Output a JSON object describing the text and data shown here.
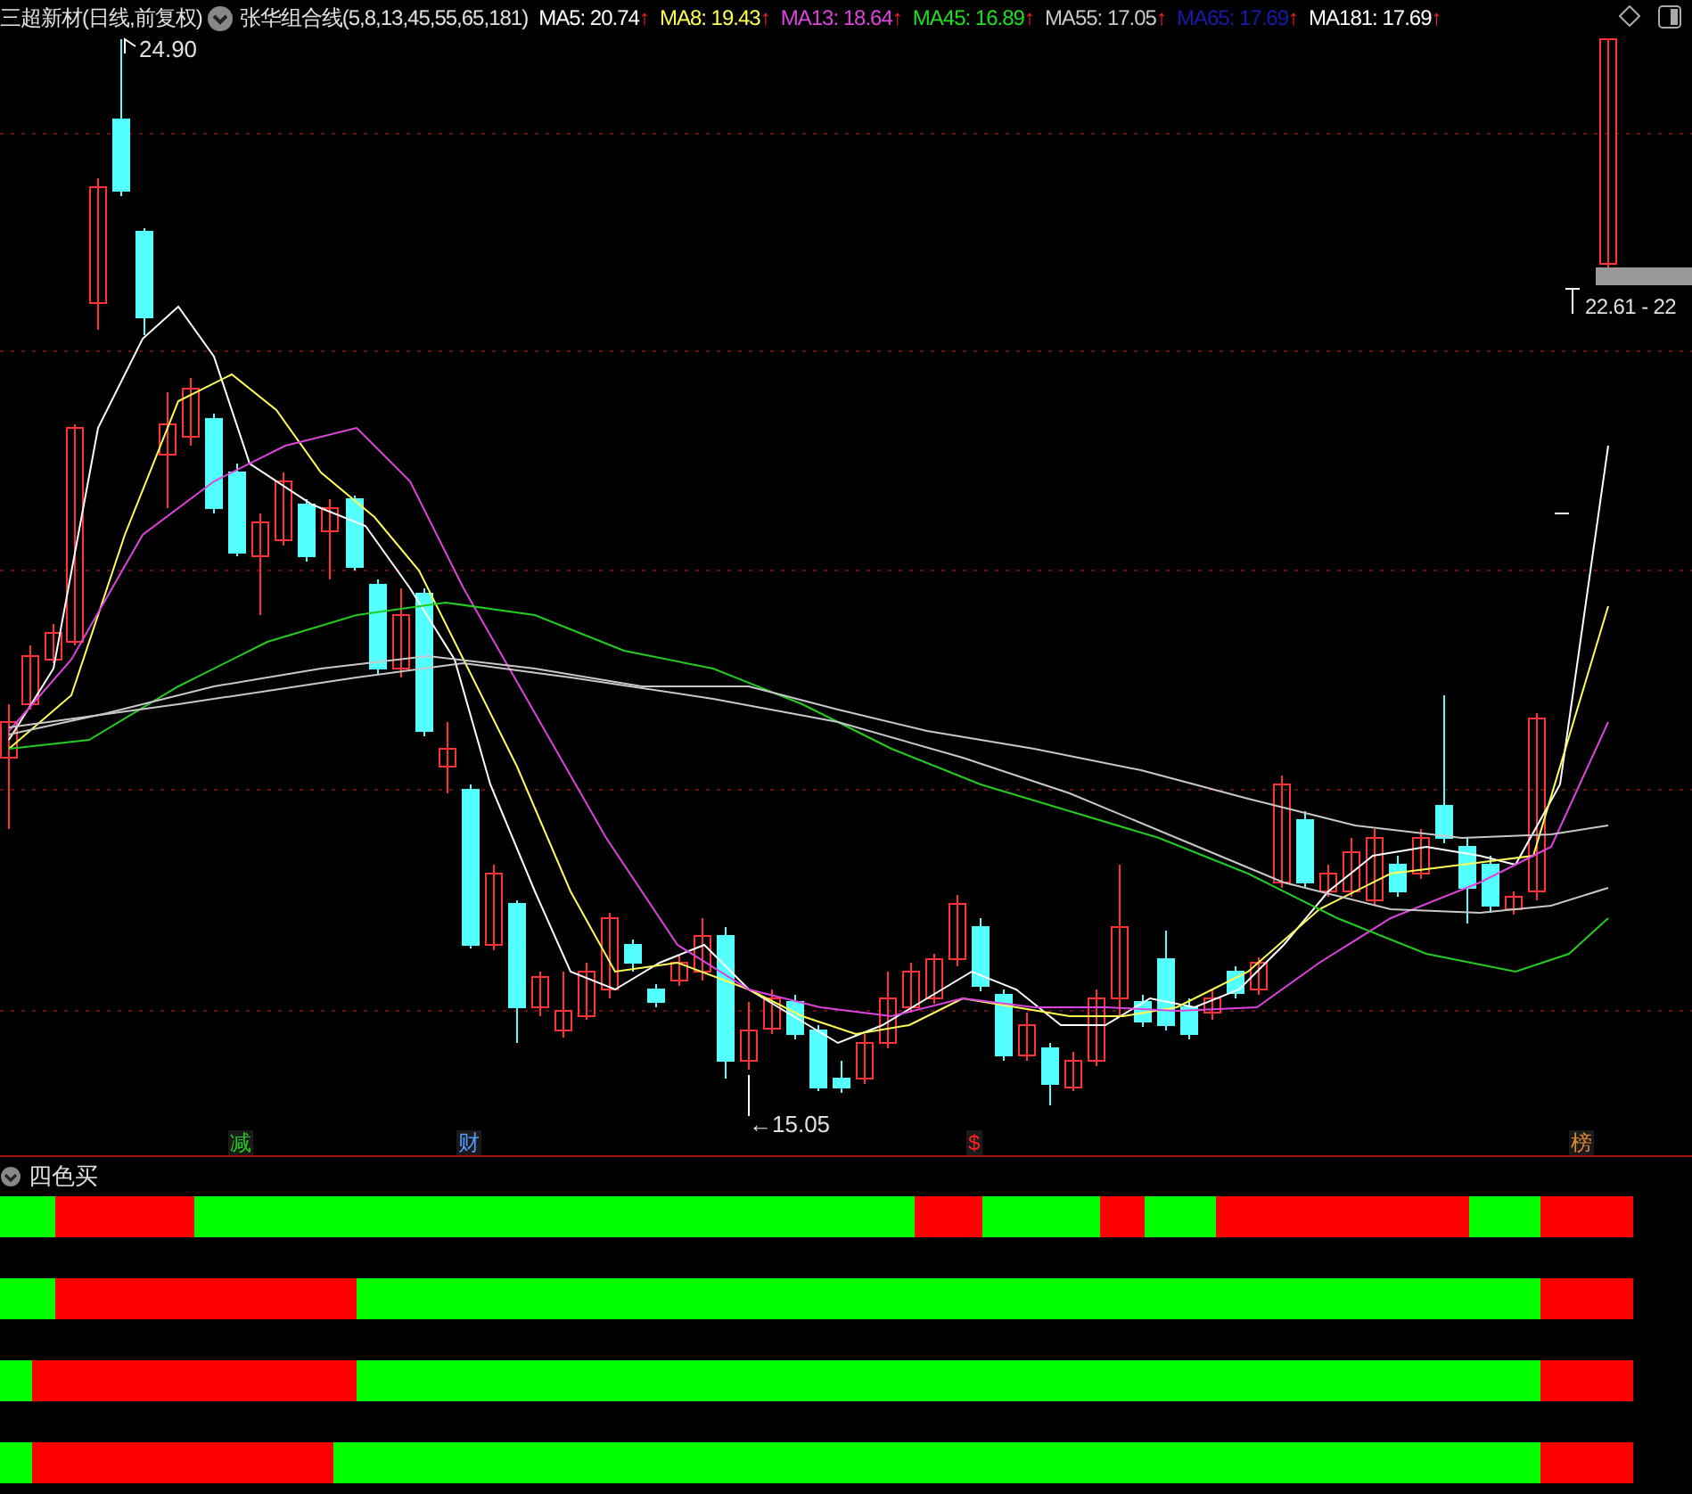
{
  "title": "三超新材(日线,前复权)",
  "indicator": {
    "name": "张华组合线(5,8,13,45,55,65,181)",
    "values": [
      {
        "label": "MA5: 20.74",
        "color": "#ffffff",
        "trend": "↑"
      },
      {
        "label": "MA8: 19.43",
        "color": "#ffff55",
        "trend": "↑"
      },
      {
        "label": "MA13: 18.64",
        "color": "#dd44dd",
        "trend": "↑"
      },
      {
        "label": "MA45: 16.89",
        "color": "#22dd22",
        "trend": "↑"
      },
      {
        "label": "MA55: 17.05",
        "color": "#c8c8c8",
        "trend": "↑"
      },
      {
        "label": "MA65: 17.69",
        "color": "#1a1aaa",
        "trend": "↑"
      },
      {
        "label": "MA181: 17.69",
        "color": "#ffffff",
        "trend": "↑"
      }
    ]
  },
  "high_label": "24.90",
  "low_label": "←15.05",
  "price_range_label": "22.61 - 22",
  "markers": [
    {
      "text": "减",
      "color": "#22cc22"
    },
    {
      "text": "财",
      "color": "#5599ff"
    },
    {
      "text": "$",
      "color": "#ff2222"
    },
    {
      "text": "榜",
      "color": "#dd8833"
    }
  ],
  "subpanel": {
    "title": "四色买"
  }
}
